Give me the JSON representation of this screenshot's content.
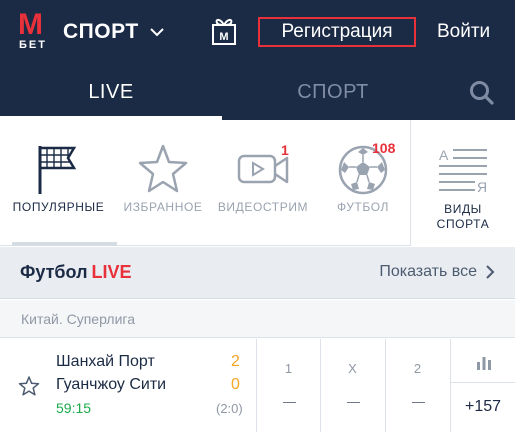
{
  "header": {
    "logo_letter": "М",
    "logo_text": "БЕТ",
    "sport_select_label": "СПОРТ",
    "gift_icon_letter": "M",
    "register_label": "Регистрация",
    "login_label": "Войти"
  },
  "tabs": {
    "live_label": "LIVE",
    "sport_label": "СПОРТ"
  },
  "categories": {
    "popular": {
      "label": "ПОПУЛЯРНЫЕ"
    },
    "favorites": {
      "label": "ИЗБРАННОЕ"
    },
    "videostream": {
      "label": "ВИДЕОСТРИМ",
      "badge": "1"
    },
    "football": {
      "label": "ФУТБОЛ",
      "badge": "108"
    },
    "sport_kinds": {
      "label_line1": "ВИДЫ",
      "label_line2": "СПОРТА",
      "icon_letter_a": "А",
      "icon_letter_ya": "Я"
    }
  },
  "section": {
    "title": "Футбол",
    "live_tag": "LIVE",
    "show_all": "Показать все"
  },
  "league": {
    "name": "Китай. Суперлига"
  },
  "match": {
    "team1": "Шанхай Порт",
    "team2": "Гуанчжоу Сити",
    "score1": "2",
    "score2": "0",
    "time": "59:15",
    "half_score": "(2:0)",
    "odds": [
      {
        "header": "1",
        "value": "—"
      },
      {
        "header": "X",
        "value": "—"
      },
      {
        "header": "2",
        "value": "—"
      }
    ],
    "more_markets": "+157"
  },
  "colors": {
    "header_bg": "#1b2a45",
    "accent_red": "#e8313a",
    "score_orange": "#f5a623",
    "time_green": "#1bab4b"
  }
}
